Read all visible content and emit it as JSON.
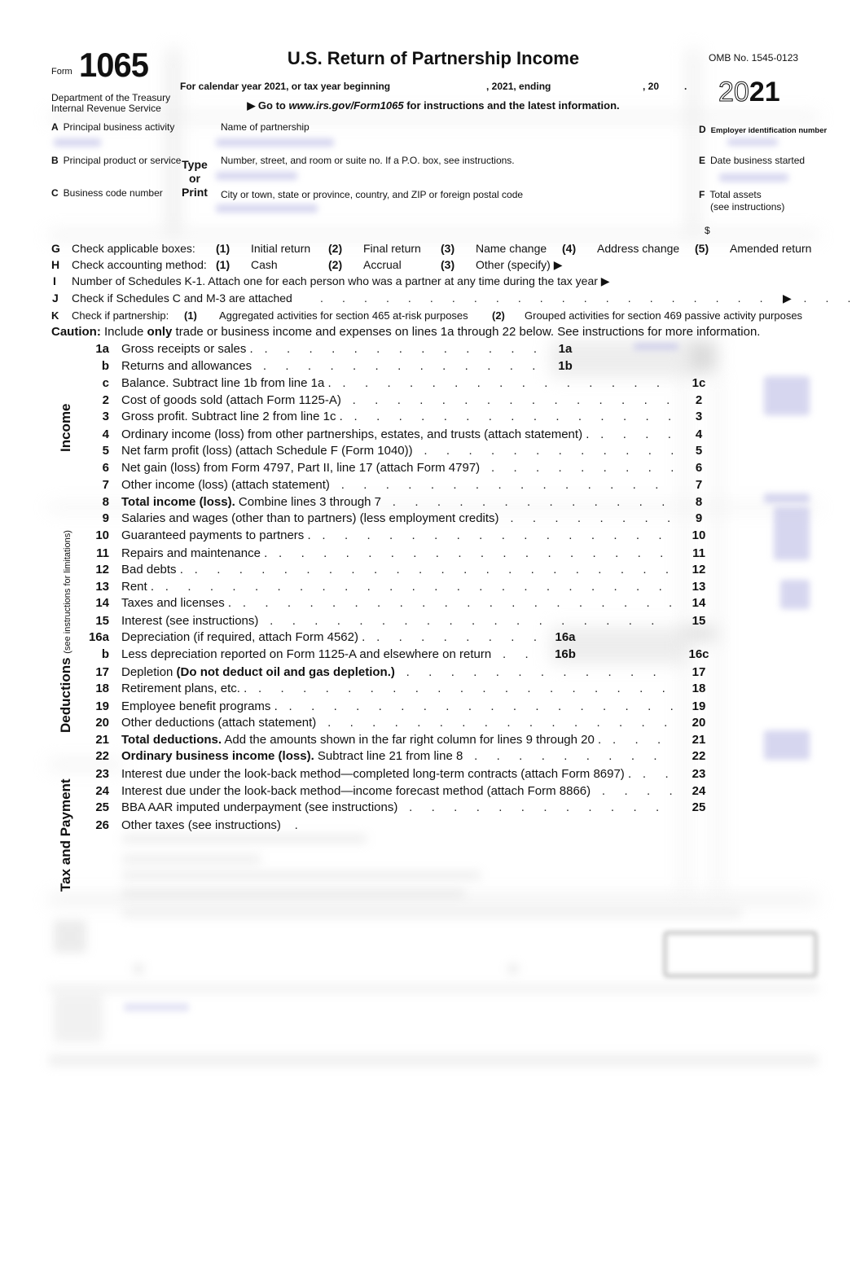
{
  "header": {
    "form_word": "Form",
    "form_number": "1065",
    "department": "Department of the Treasury",
    "agency": "Internal Revenue Service",
    "title": "U.S. Return of Partnership Income",
    "calendar_year_text": "For calendar year 2021, or tax year beginning",
    "ending_text": ", 2021, ending",
    "twenty_text": ", 20",
    "period": ".",
    "goto_prefix": "▶ Go to ",
    "goto_url": "www.irs.gov/Form1065",
    "goto_suffix": " for instructions and the latest information.",
    "omb": "OMB No. 1545-0123",
    "year_outline": "20",
    "year_bold": "21"
  },
  "entity": {
    "A_letter": "A",
    "A_label": "Principal business activity",
    "B_letter": "B",
    "B_label": "Principal product or service",
    "C_letter": "C",
    "C_label": "Business code number",
    "type_print": [
      "Type",
      "or",
      "Print"
    ],
    "name_label": "Name of partnership",
    "street_label": "Number, street, and room or suite no. If a P.O. box, see instructions.",
    "city_label": "City or town, state or province, country, and ZIP or foreign postal code",
    "D_letter": "D",
    "D_label": "Employer identification number",
    "E_letter": "E",
    "E_label": "Date business started",
    "F_letter": "F",
    "F_label": "Total assets",
    "F_sub": "(see instructions)",
    "dollar": "$"
  },
  "checks": {
    "G": {
      "letter": "G",
      "label": "Check applicable boxes:",
      "options": [
        {
          "num": "(1)",
          "label": "Initial return"
        },
        {
          "num": "(2)",
          "label": "Final return"
        },
        {
          "num": "(3)",
          "label": "Name change"
        },
        {
          "num": "(4)",
          "label": "Address change"
        },
        {
          "num": "(5)",
          "label": "Amended return"
        }
      ]
    },
    "H": {
      "letter": "H",
      "label": "Check accounting method:",
      "options": [
        {
          "num": "(1)",
          "label": "Cash"
        },
        {
          "num": "(2)",
          "label": "Accrual"
        },
        {
          "num": "(3)",
          "label": "Other (specify) ▶"
        }
      ]
    },
    "I": {
      "letter": "I",
      "label": "Number of Schedules K-1. Attach one for each person who was a partner at any time during the tax year ▶"
    },
    "J": {
      "letter": "J",
      "label": "Check if Schedules C and M-3 are attached",
      "arrow": "▶"
    },
    "K": {
      "letter": "K",
      "label": "Check if partnership:",
      "options": [
        {
          "num": "(1)",
          "label": "Aggregated activities for section 465 at-risk purposes"
        },
        {
          "num": "(2)",
          "label": "Grouped activities for section 469 passive activity purposes"
        }
      ]
    },
    "caution_bold": "Caution:",
    "caution_1": " Include ",
    "caution_only": "only",
    "caution_2": " trade or business income and expenses on lines 1a through 22 below. See instructions for more information."
  },
  "sections": {
    "income": "Income",
    "deductions": "Deductions",
    "deductions_note": "(see instructions for limitations)",
    "tax_payment": "Tax and Payment"
  },
  "lines": [
    {
      "ln": "1a",
      "bold": "",
      "text": "Gross receipts or sales .",
      "mid": "1a",
      "right": ""
    },
    {
      "ln": "b",
      "bold": "",
      "text": "Returns and allowances",
      "mid": "1b",
      "right": ""
    },
    {
      "ln": "c",
      "bold": "",
      "text": "Balance. Subtract line 1b from line 1a .",
      "mid": "",
      "right": "1c"
    },
    {
      "ln": "2",
      "bold": "",
      "text": "Cost of goods sold (attach Form 1125-A)",
      "mid": "",
      "right": "2"
    },
    {
      "ln": "3",
      "bold": "",
      "text": "Gross profit. Subtract line 2 from line 1c .",
      "mid": "",
      "right": "3"
    },
    {
      "ln": "4",
      "bold": "",
      "text": "Ordinary income (loss) from other partnerships, estates, and trusts (attach statement) .",
      "mid": "",
      "right": "4"
    },
    {
      "ln": "5",
      "bold": "",
      "text": "Net farm profit (loss) (attach Schedule F (Form 1040))",
      "mid": "",
      "right": "5"
    },
    {
      "ln": "6",
      "bold": "",
      "text": "Net gain (loss) from Form 4797, Part II, line 17 (attach Form 4797)",
      "mid": "",
      "right": "6"
    },
    {
      "ln": "7",
      "bold": "",
      "text": "Other income (loss) (attach statement)",
      "mid": "",
      "right": "7"
    },
    {
      "ln": "8",
      "bold": "Total income (loss).",
      "text": " Combine lines 3 through 7",
      "mid": "",
      "right": "8"
    },
    {
      "ln": "9",
      "bold": "",
      "text": "Salaries and wages (other than to partners) (less employment credits)",
      "mid": "",
      "right": "9"
    },
    {
      "ln": "10",
      "bold": "",
      "text": "Guaranteed payments to partners .",
      "mid": "",
      "right": "10"
    },
    {
      "ln": "11",
      "bold": "",
      "text": "Repairs and maintenance .",
      "mid": "",
      "right": "11"
    },
    {
      "ln": "12",
      "bold": "",
      "text": "Bad debts .",
      "mid": "",
      "right": "12"
    },
    {
      "ln": "13",
      "bold": "",
      "text": "Rent .",
      "mid": "",
      "right": "13"
    },
    {
      "ln": "14",
      "bold": "",
      "text": "Taxes and licenses .",
      "mid": "",
      "right": "14"
    },
    {
      "ln": "15",
      "bold": "",
      "text": "Interest (see instructions)",
      "mid": "",
      "right": "15"
    },
    {
      "ln": "16a",
      "bold": "",
      "text": "Depreciation (if required, attach Form 4562) .",
      "mid": "16a",
      "right": ""
    },
    {
      "ln": "b",
      "bold": "",
      "text": "Less depreciation reported on Form 1125-A and elsewhere on return",
      "mid": "16b",
      "right": "16c"
    },
    {
      "ln": "17",
      "bold": "",
      "text": "Depletion ",
      "bold2": "(Do not deduct oil and gas depletion.)",
      "mid": "",
      "right": "17"
    },
    {
      "ln": "18",
      "bold": "",
      "text": "Retirement plans, etc. .",
      "mid": "",
      "right": "18"
    },
    {
      "ln": "19",
      "bold": "",
      "text": "Employee benefit programs .",
      "mid": "",
      "right": "19"
    },
    {
      "ln": "20",
      "bold": "",
      "text": "Other deductions (attach statement)",
      "mid": "",
      "right": "20"
    },
    {
      "ln": "21",
      "bold": "Total deductions.",
      "text": " Add the amounts shown in the far right column for lines 9 through 20 .",
      "mid": "",
      "right": "21"
    },
    {
      "ln": "22",
      "bold": "Ordinary business income (loss).",
      "text": " Subtract line 21 from line 8",
      "mid": "",
      "right": "22"
    },
    {
      "ln": "23",
      "bold": "",
      "text": "Interest due under the look-back method—completed long-term contracts (attach Form 8697) .",
      "mid": "",
      "right": "23"
    },
    {
      "ln": "24",
      "bold": "",
      "text": "Interest due under the look-back method—income forecast method (attach Form 8866)",
      "mid": "",
      "right": "24"
    },
    {
      "ln": "25",
      "bold": "",
      "text": "BBA AAR imputed underpayment (see instructions)",
      "mid": "",
      "right": "25"
    },
    {
      "ln": "26",
      "bold": "",
      "text": "Other taxes (see instructions)",
      "mid": "",
      "right": ""
    }
  ]
}
